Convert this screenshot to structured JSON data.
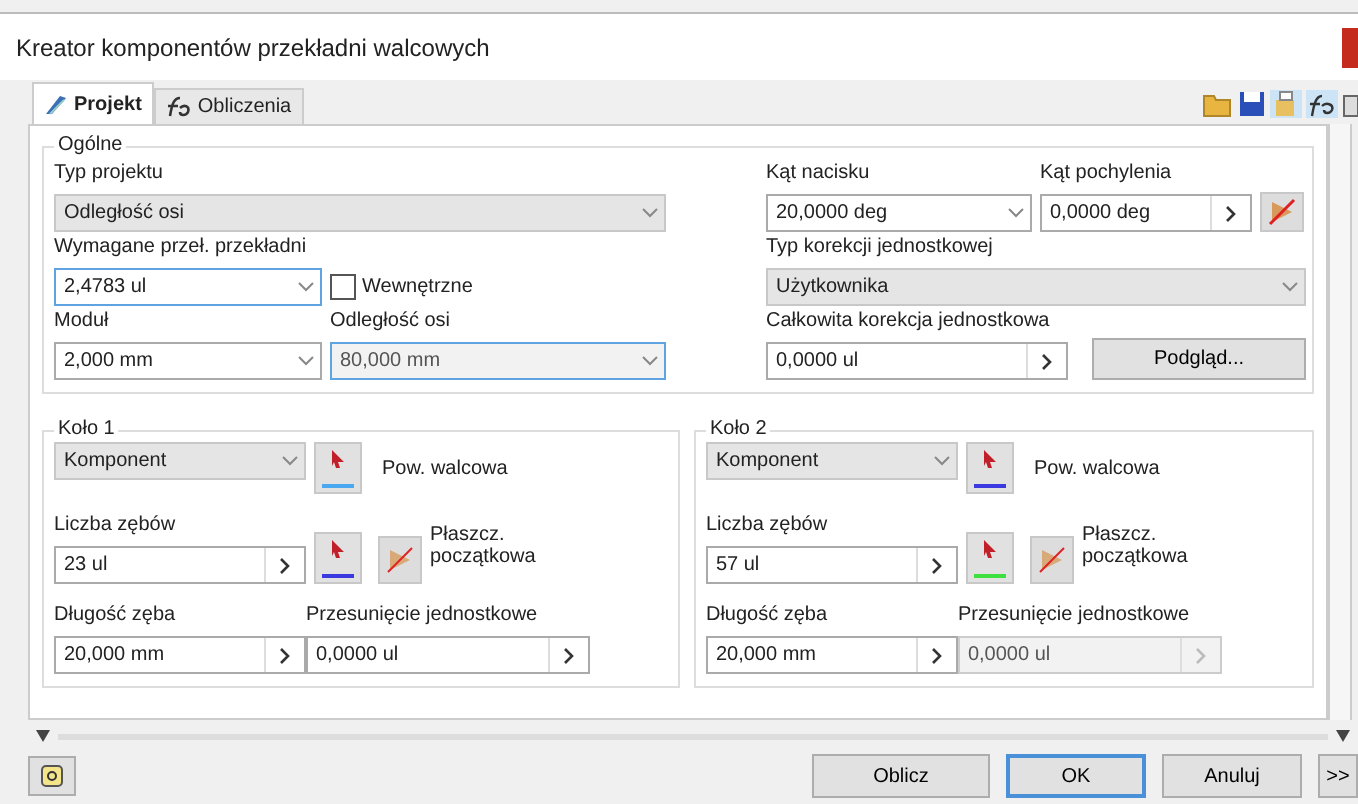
{
  "window": {
    "title": "Kreator komponentów przekładni walcowych"
  },
  "tabs": [
    {
      "label": "Projekt",
      "selected": true
    },
    {
      "label": "Obliczenia",
      "selected": false
    }
  ],
  "general": {
    "legend": "Ogólne",
    "design_type": {
      "label": "Typ projektu",
      "value": "Odległość osi",
      "kind": "dropdown"
    },
    "ratio": {
      "label": "Wymagane przeł. przekładni",
      "value": "2,4783 ul",
      "kind": "combo",
      "highlighted": true
    },
    "internal": {
      "label": "Wewnętrzne",
      "checked": false
    },
    "module": {
      "label": "Moduł",
      "value": "2,000 mm",
      "kind": "combo"
    },
    "center_distance": {
      "label": "Odległość osi",
      "value": "80,000 mm",
      "kind": "combo",
      "disabled": true,
      "highlighted": true
    },
    "pressure_angle": {
      "label": "Kąt nacisku",
      "value": "20,0000 deg",
      "kind": "combo"
    },
    "helix_angle": {
      "label": "Kąt pochylenia",
      "value": "0,0000 deg",
      "kind": "spin"
    },
    "correction_type": {
      "label": "Typ korekcji jednostkowej",
      "value": "Użytkownika",
      "kind": "dropdown"
    },
    "total_correction": {
      "label": "Całkowita korekcja jednostkowa",
      "value": "0,0000 ul",
      "kind": "spin"
    },
    "preview_button": "Podgląd..."
  },
  "gears": [
    {
      "legend": "Koło 1",
      "type": {
        "value": "Komponent",
        "kind": "dropdown"
      },
      "surface_label": "Pow. walcowa",
      "surface_pick": {
        "color": "#4aa8f0"
      },
      "plane_pick": {
        "color": "#3a3ae0"
      },
      "plane_label": "Płaszcz. początkowa",
      "teeth": {
        "label": "Liczba zębów",
        "value": "23 ul",
        "kind": "spin"
      },
      "width": {
        "label": "Długość zęba",
        "value": "20,000 mm",
        "kind": "spin"
      },
      "shift": {
        "label": "Przesunięcie jednostkowe",
        "value": "0,0000 ul",
        "kind": "spin",
        "disabled": false
      }
    },
    {
      "legend": "Koło 2",
      "type": {
        "value": "Komponent",
        "kind": "dropdown"
      },
      "surface_label": "Pow. walcowa",
      "surface_pick": {
        "color": "#3a3ae0"
      },
      "plane_pick": {
        "color": "#3ee03e"
      },
      "plane_label": "Płaszcz. początkowa",
      "teeth": {
        "label": "Liczba zębów",
        "value": "57 ul",
        "kind": "spin"
      },
      "width": {
        "label": "Długość zęba",
        "value": "20,000 mm",
        "kind": "spin"
      },
      "shift": {
        "label": "Przesunięcie jednostkowe",
        "value": "0,0000 ul",
        "kind": "spin",
        "disabled": true
      }
    }
  ],
  "buttons": [
    {
      "label": "Oblicz",
      "default": false
    },
    {
      "label": "OK",
      "default": true
    },
    {
      "label": "Anuluj",
      "default": false
    },
    {
      "label": ">>",
      "default": false
    }
  ]
}
